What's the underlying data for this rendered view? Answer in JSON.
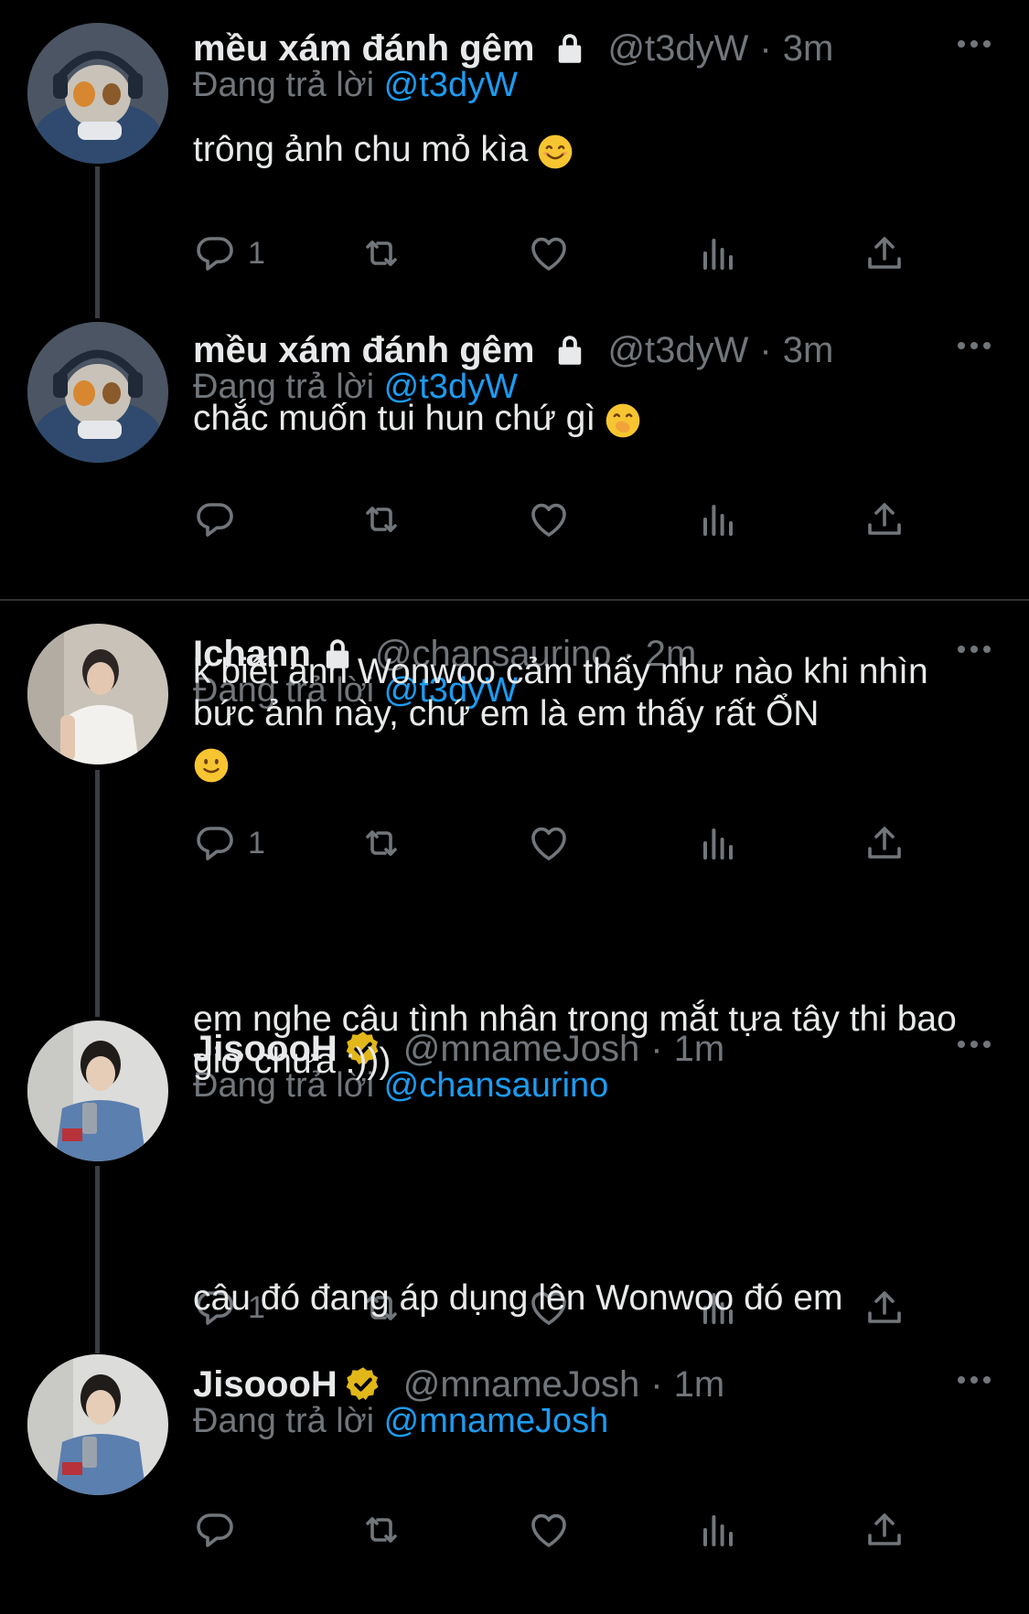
{
  "tweets": [
    {
      "name": "mều xám đánh gêm",
      "handle": "@t3dyW",
      "sep": "·",
      "time": "3m",
      "reply_prefix": "Đang trả lời",
      "reply_to": "@t3dyW",
      "text": "trông ảnh chu mỏ kìa",
      "emoji": "smiling-face-emoji",
      "reply_count": "1",
      "badge": "lock-icon"
    },
    {
      "name": "mều xám đánh gêm",
      "handle": "@t3dyW",
      "sep": "·",
      "time": "3m",
      "reply_prefix": "Đang trả lời",
      "reply_to": "@t3dyW",
      "text": "chắc muốn tui hun chứ gì",
      "emoji": "hand-over-mouth-emoji",
      "reply_count": "",
      "badge": "lock-icon"
    },
    {
      "name": "Ichann",
      "handle": "@chansaurino",
      "sep": "·",
      "time": "2m",
      "reply_prefix": "Đang trả lời",
      "reply_to": "@t3dyW",
      "text": "k biết anh Wonwoo cảm thấy như nào khi nhìn bức ảnh này, chứ em là em thấy rất ỔN",
      "emoji": "slightly-smiling-emoji",
      "reply_count": "1",
      "badge": "lock-icon"
    },
    {
      "name": "JisoooH",
      "handle": "@mnameJosh",
      "sep": "·",
      "time": "1m",
      "reply_prefix": "Đang trả lời",
      "reply_to": "@chansaurino",
      "text": "em nghe câu tình nhân trong mắt tựa tây thi bao giờ chưa :)))",
      "reply_count": "1",
      "badge": "verified-icon"
    },
    {
      "name": "JisoooH",
      "handle": "@mnameJosh",
      "sep": "·",
      "time": "1m",
      "reply_prefix": "Đang trả lời",
      "reply_to": "@mnameJosh",
      "text": "câu đó đang áp dụng lên Wonwoo đó em",
      "reply_count": "",
      "badge": "verified-icon"
    }
  ],
  "colors": {
    "background": "#000000",
    "text": "#e7e9ea",
    "muted": "#71767b",
    "link": "#1d9bf0",
    "verified": "#e2b719"
  }
}
